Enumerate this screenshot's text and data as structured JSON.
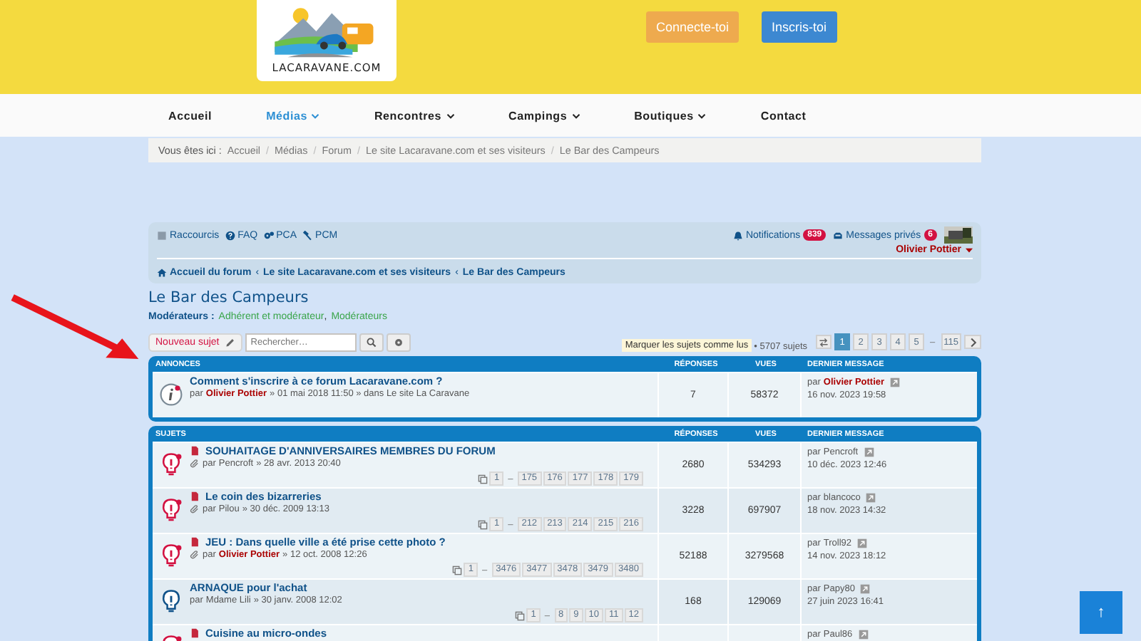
{
  "header": {
    "logo_text": "LACARAVANE.COM",
    "buttons": [
      {
        "label": "Connecte-toi",
        "kind": "login"
      },
      {
        "label": "Inscris-toi",
        "kind": "register"
      }
    ]
  },
  "nav": [
    {
      "label": "Accueil",
      "selected": false,
      "dropdown": false
    },
    {
      "label": "Médias",
      "selected": true,
      "dropdown": true
    },
    {
      "label": "Rencontres",
      "selected": false,
      "dropdown": true
    },
    {
      "label": "Campings",
      "selected": false,
      "dropdown": true
    },
    {
      "label": "Boutiques",
      "selected": false,
      "dropdown": true
    },
    {
      "label": "Contact",
      "selected": false,
      "dropdown": false
    }
  ],
  "breadcrumb": {
    "prefix": "Vous êtes ici :",
    "separator": "/",
    "items": [
      "Accueil",
      "Médias",
      "Forum",
      "Le site Lacaravane.com et ses visiteurs",
      "Le Bar des Campeurs"
    ]
  },
  "forum_bar": {
    "links": [
      {
        "label": "Raccourcis",
        "kind": "shortcuts"
      },
      {
        "label": "FAQ",
        "kind": "faq"
      },
      {
        "label": "PCA",
        "kind": "admin"
      },
      {
        "label": "PCM",
        "kind": "mod"
      }
    ],
    "notifications": {
      "label": "Notifications",
      "count": "839"
    },
    "messages": {
      "label": "Messages privés",
      "count": "6"
    },
    "user": "Olivier Pottier",
    "crumb_separator": "‹",
    "crumbs": [
      "Accueil du forum",
      "Le site Lacaravane.com et ses visiteurs",
      "Le Bar des Campeurs"
    ]
  },
  "forum_title": "Le Bar des Campeurs",
  "moderators": {
    "label": "Modérateurs :",
    "separator": ",",
    "items": [
      "Adhérent et modérateur",
      "Modérateurs"
    ]
  },
  "actions": {
    "new_topic": "Nouveau sujet",
    "search_placeholder": "Rechercher…",
    "mark_read": "Marquer les sujets comme lus",
    "count": "• 5707 sujets",
    "pages": [
      {
        "label": "1",
        "selected": true
      },
      {
        "label": "2",
        "selected": false
      },
      {
        "label": "3",
        "selected": false
      },
      {
        "label": "4",
        "selected": false
      },
      {
        "label": "5",
        "selected": false
      }
    ],
    "gap": "–",
    "last_page": "115"
  },
  "sections": [
    {
      "title": "ANNONCES",
      "columns": [
        "RÉPONSES",
        "VUES",
        "DERNIER MESSAGE"
      ],
      "topics": [
        {
          "kind": "announce",
          "title": "Comment s'inscrire à ce forum Lacaravane.com ?",
          "by": "par",
          "author": "Olivier Pottier",
          "author_highlight": true,
          "date": "» 01 mai 2018 11:50 » dans Le site La Caravane",
          "attachment": false,
          "sticky": false,
          "replies": "7",
          "views": "58372",
          "last_prefix": "par",
          "last_by": "Olivier Pottier",
          "last_highlight": true,
          "last_date": "16 nov. 2023 19:58"
        }
      ]
    },
    {
      "title": "SUJETS",
      "columns": [
        "RÉPONSES",
        "VUES",
        "DERNIER MESSAGE"
      ],
      "topics": [
        {
          "kind": "hot",
          "title": "SOUHAITAGE D'ANNIVERSAIRES MEMBRES DU FORUM",
          "by": "par",
          "author": "Pencroft",
          "author_highlight": false,
          "date": "» 28 avr. 2013 20:40",
          "attachment": true,
          "sticky": true,
          "first_page": "1",
          "gap": "–",
          "pages": [
            "175",
            "176",
            "177",
            "178",
            "179"
          ],
          "replies": "2680",
          "views": "534293",
          "last_prefix": "par",
          "last_by": "Pencroft",
          "last_highlight": false,
          "last_date": "10 déc. 2023 12:46"
        },
        {
          "kind": "hot",
          "title": "Le coin des bizarreries",
          "by": "par",
          "author": "Pilou",
          "author_highlight": false,
          "date": "» 30 déc. 2009 13:13",
          "attachment": true,
          "sticky": true,
          "first_page": "1",
          "gap": "–",
          "pages": [
            "212",
            "213",
            "214",
            "215",
            "216"
          ],
          "replies": "3228",
          "views": "697907",
          "last_prefix": "par",
          "last_by": "blancoco",
          "last_highlight": false,
          "last_date": "18 nov. 2023 14:32"
        },
        {
          "kind": "hot",
          "title": "JEU : Dans quelle ville a été prise cette photo ?",
          "by": "par",
          "author": "Olivier Pottier",
          "author_highlight": true,
          "date": "» 12 oct. 2008 12:26",
          "attachment": true,
          "sticky": true,
          "first_page": "1",
          "gap": "–",
          "pages": [
            "3476",
            "3477",
            "3478",
            "3479",
            "3480"
          ],
          "replies": "52188",
          "views": "3279568",
          "last_prefix": "par",
          "last_by": "Troll92",
          "last_highlight": false,
          "last_date": "14 nov. 2023 18:12"
        },
        {
          "kind": "normal",
          "title": "ARNAQUE pour l'achat",
          "by": "par",
          "author": "Mdame Lili",
          "author_highlight": false,
          "date": "» 30 janv. 2008 12:02",
          "attachment": false,
          "sticky": false,
          "first_page": "1",
          "gap": "–",
          "pages": [
            "8",
            "9",
            "10",
            "11",
            "12"
          ],
          "replies": "168",
          "views": "129069",
          "last_prefix": "par",
          "last_by": "Papy80",
          "last_highlight": false,
          "last_date": "27 juin 2023 16:41"
        },
        {
          "kind": "hot",
          "title": "Cuisine au micro-ondes",
          "sticky": true,
          "attachment": false,
          "last_prefix": "par",
          "last_by": "Paul86",
          "last_highlight": false
        }
      ]
    }
  ],
  "scroll_top": "↑"
}
